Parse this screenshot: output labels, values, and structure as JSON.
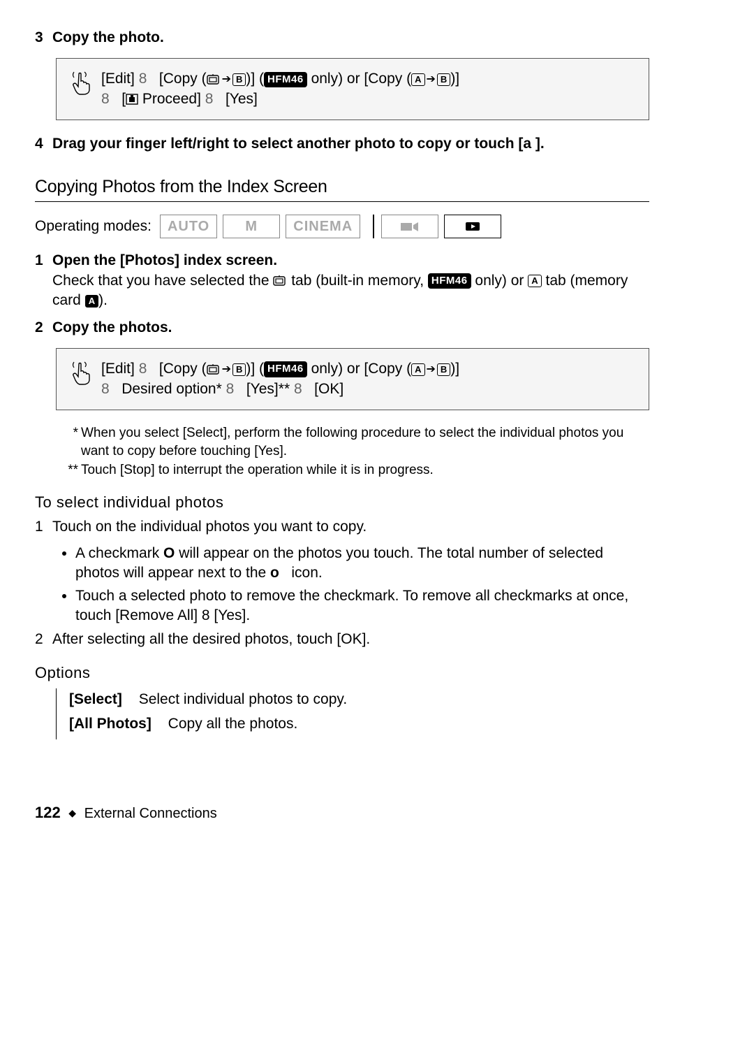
{
  "step3": {
    "num": "3",
    "title": "Copy the photo."
  },
  "box1": {
    "edit": "[Edit]",
    "sep": "8",
    "copy_pre": "[Copy (",
    "copy_post": ")]",
    "model": "HFM46",
    "only": " only) or [Copy (",
    "a": "A",
    "b": "B",
    "close": ")]",
    "proceed": " Proceed]",
    "yes": "[Yes]"
  },
  "step4": {
    "num": "4",
    "text": "Drag your finger left/right to select another photo to copy or touch [a   ]."
  },
  "section2": "Copying Photos from the Index Screen",
  "opmodes_label": "Operating modes:",
  "modes": {
    "auto": "AUTO",
    "m": "M",
    "cinema": "CINEMA"
  },
  "s2_step1": {
    "num": "1",
    "title": "Open the [Photos] index screen.",
    "desc_a": "Check that you have selected the ",
    "desc_b": " tab (built-in memory, ",
    "model": "HFM46",
    "desc_c": " only) or ",
    "desc_d": " tab (memory card ",
    "desc_e": ")."
  },
  "s2_step2": {
    "num": "2",
    "title": "Copy the photos."
  },
  "box2": {
    "desired": "Desired option*",
    "yes2": "[Yes]**",
    "ok": "[OK]"
  },
  "fn1": "When you select [Select], perform the following procedure to select the individual photos you want to copy before touching [Yes].",
  "fn2": "Touch [Stop] to interrupt the operation while it is in progress.",
  "mini_head": "To select individual photos",
  "sel_step1": {
    "num": "1",
    "text": "Touch on the individual photos you want to copy."
  },
  "sel_b1a": "A checkmark ",
  "sel_b1b": " will appear on the photos you touch. The total number of selected photos will appear next to the ",
  "sel_b1c": " icon.",
  "sel_b2": "Touch a selected photo to remove the checkmark. To remove all checkmarks at once, touch [Remove All] 8   [Yes].",
  "sel_step2": {
    "num": "2",
    "text": "After selecting all the desired photos, touch [OK]."
  },
  "options_head": "Options",
  "opt_select_label": "[Select]",
  "opt_select_desc": "Select individual photos to copy.",
  "opt_all_label": "[All Photos]",
  "opt_all_desc": "Copy all the photos.",
  "footer": {
    "page": "122",
    "section": "External Connections"
  }
}
